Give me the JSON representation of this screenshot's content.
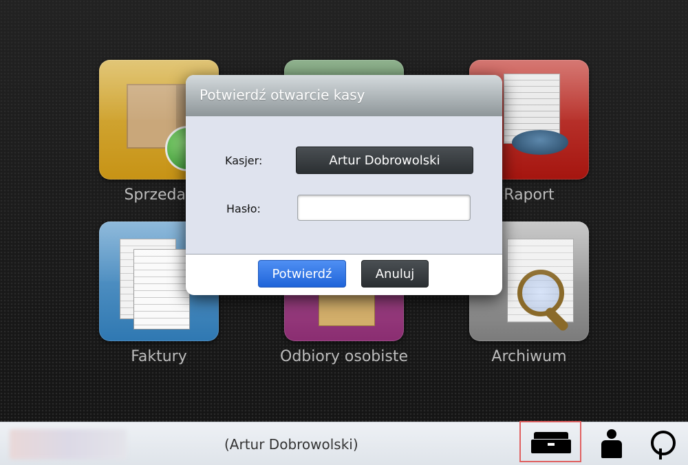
{
  "tiles": [
    {
      "name": "tile-sprzedaz",
      "label": "Sprzedaż"
    },
    {
      "name": "tile-green",
      "label": ""
    },
    {
      "name": "tile-raport",
      "label": "Raport"
    },
    {
      "name": "tile-faktury",
      "label": "Faktury"
    },
    {
      "name": "tile-odbiory",
      "label": "Odbiory osobiste"
    },
    {
      "name": "tile-archiwum",
      "label": "Archiwum"
    }
  ],
  "modal": {
    "title": "Potwierdź otwarcie kasy",
    "cashier_label": "Kasjer:",
    "cashier_value": "Artur Dobrowolski",
    "password_label": "Hasło:",
    "password_value": "",
    "confirm_label": "Potwierdź",
    "cancel_label": "Anuluj"
  },
  "bottombar": {
    "user_name": "(Artur Dobrowolski)",
    "icons": [
      "cash-drawer-icon",
      "user-icon",
      "power-icon"
    ]
  },
  "colors": {
    "accent_blue": "#1f64d9",
    "dark_button": "#2b2f32",
    "highlight_border": "#e06060"
  }
}
